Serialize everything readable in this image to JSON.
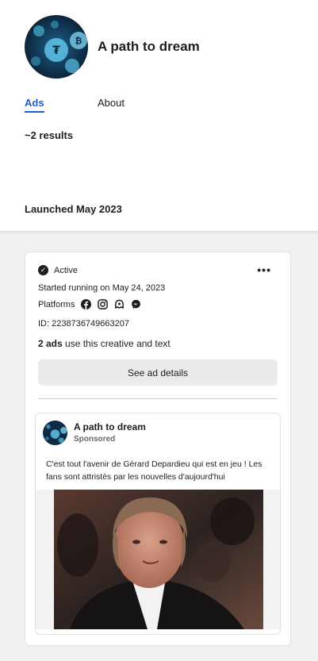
{
  "page": {
    "name": "A path to dream",
    "tabs": [
      "Ads",
      "About"
    ],
    "results": "~2 results",
    "launched": "Launched May 2023"
  },
  "ad_card": {
    "status": "Active",
    "started": "Started running on May 24, 2023",
    "platforms_label": "Platforms",
    "platforms": [
      "facebook-icon",
      "instagram-icon",
      "audience-network-icon",
      "messenger-icon"
    ],
    "id_text": "ID: 2238736749663207",
    "ads_count_bold": "2 ads",
    "ads_count_rest": " use this creative and text",
    "see_details": "See ad details",
    "more_label": "•••"
  },
  "preview": {
    "name": "A path to dream",
    "sponsored": "Sponsored",
    "text": "C'est tout l'avenir de Gèrard Depardieu qui est en jeu ! Les fans sont attristès par les nouvelles d'aujourd'hui"
  },
  "colors": {
    "accent": "#1a5fd6",
    "background": "#f0f0f0",
    "button_bg": "#ebebeb"
  }
}
